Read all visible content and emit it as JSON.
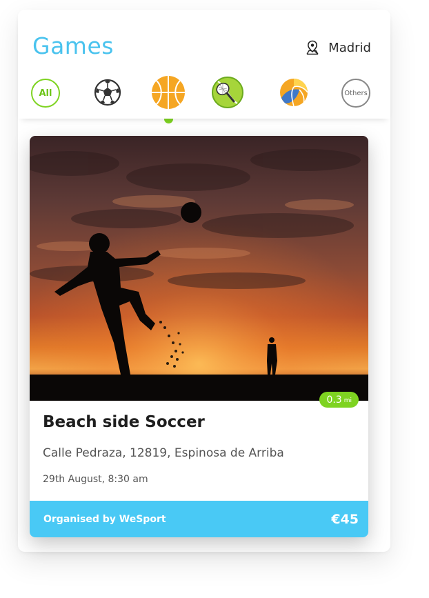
{
  "header": {
    "title": "Games",
    "location": "Madrid",
    "location_icon": "map-pin-icon"
  },
  "categories": [
    {
      "label": "All",
      "icon": "all-badge",
      "color": "#7ed321"
    },
    {
      "label": "",
      "icon": "soccer-ball-icon"
    },
    {
      "label": "",
      "icon": "basketball-icon",
      "selected": true,
      "color": "#f5a623"
    },
    {
      "label": "",
      "icon": "tennis-icon",
      "color": "#7ed321"
    },
    {
      "label": "",
      "icon": "volleyball-icon"
    },
    {
      "label": "Others",
      "icon": "others-badge"
    }
  ],
  "game": {
    "title": "Beach side Soccer",
    "address": "Calle Pedraza, 12819, Espinosa de Arriba",
    "datetime": "29th August, 8:30 am",
    "distance_value": "0.3",
    "distance_unit": "mi",
    "organiser": "Organised by WeSport",
    "price": "€45"
  },
  "colors": {
    "accent_blue": "#4ac3ee",
    "accent_green": "#7ed321",
    "footer_blue": "#49c9f5"
  }
}
